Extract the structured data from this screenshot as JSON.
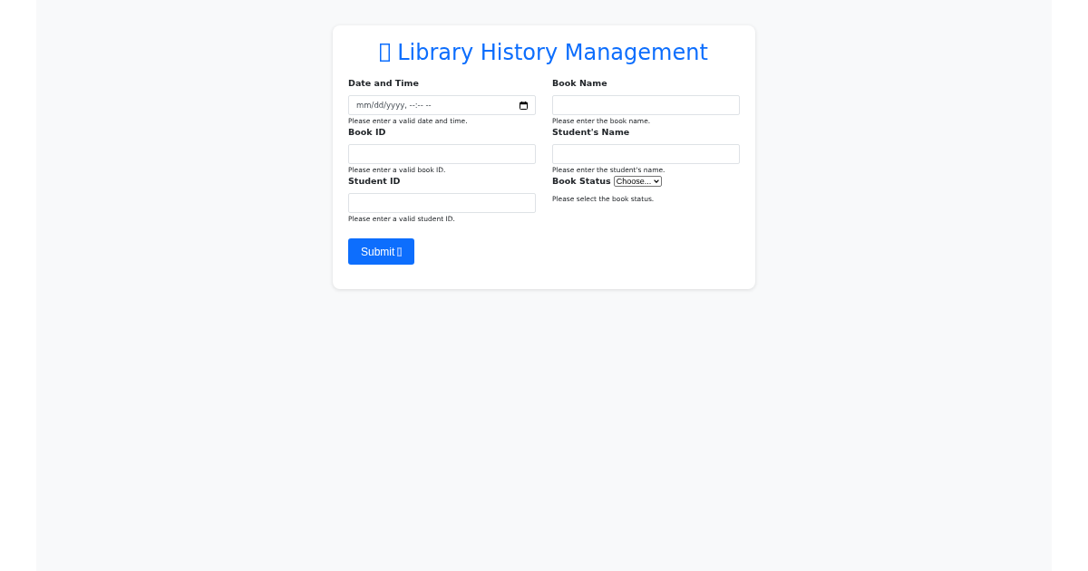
{
  "title": "Library History Management",
  "columns": [
    {
      "fields": [
        {
          "kind": "datetime",
          "label": "Date and Time",
          "placeholder": "mm/dd/yyyy, --:-- --",
          "help": "Please enter a valid date and time."
        },
        {
          "kind": "text",
          "label": "Book ID",
          "help": "Please enter a valid book ID."
        },
        {
          "kind": "text",
          "label": "Student ID",
          "help": "Please enter a valid student ID."
        }
      ]
    },
    {
      "fields": [
        {
          "kind": "text",
          "label": "Book Name",
          "help": "Please enter the book name."
        },
        {
          "kind": "text",
          "label": "Student's Name",
          "help": "Please enter the student's name."
        },
        {
          "kind": "select",
          "label": "Book Status",
          "value": "Choose...",
          "help": "Please select the book status."
        }
      ]
    }
  ],
  "submit_button": {
    "label": "Submit"
  }
}
